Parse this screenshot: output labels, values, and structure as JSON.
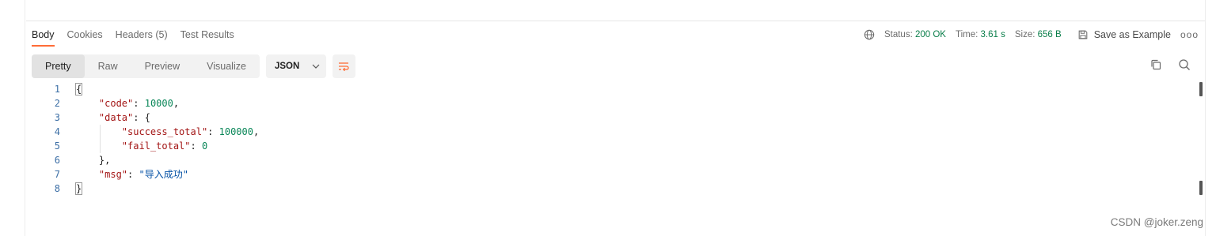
{
  "response_tabs": [
    {
      "label": "Body",
      "active": true
    },
    {
      "label": "Cookies",
      "active": false
    },
    {
      "label": "Headers (5)",
      "active": false
    },
    {
      "label": "Test Results",
      "active": false
    }
  ],
  "meta": {
    "status_label": "Status:",
    "status_value": "200 OK",
    "time_label": "Time:",
    "time_value": "3.61 s",
    "size_label": "Size:",
    "size_value": "656 B",
    "save_label": "Save as Example",
    "more_label": "ooo"
  },
  "view_modes": [
    {
      "label": "Pretty",
      "active": true
    },
    {
      "label": "Raw",
      "active": false
    },
    {
      "label": "Preview",
      "active": false
    },
    {
      "label": "Visualize",
      "active": false
    }
  ],
  "format": {
    "selected": "JSON"
  },
  "code_lines": [
    {
      "n": "1"
    },
    {
      "n": "2"
    },
    {
      "n": "3"
    },
    {
      "n": "4"
    },
    {
      "n": "5"
    },
    {
      "n": "6"
    },
    {
      "n": "7"
    },
    {
      "n": "8"
    }
  ],
  "json": {
    "open": "{",
    "close": "}",
    "code_key": "\"code\"",
    "code_val": "10000",
    "data_key": "\"data\"",
    "success_key": "\"success_total\"",
    "success_val": "100000",
    "fail_key": "\"fail_total\"",
    "fail_val": "0",
    "data_close": "},",
    "msg_key": "\"msg\"",
    "msg_val": "\"导入成功\""
  },
  "watermark": "CSDN @joker.zeng",
  "colors": {
    "accent": "#ff6c37",
    "status_ok": "#0a7e4a",
    "json_key": "#a31515",
    "json_number": "#098658",
    "json_string": "#0451a5"
  }
}
